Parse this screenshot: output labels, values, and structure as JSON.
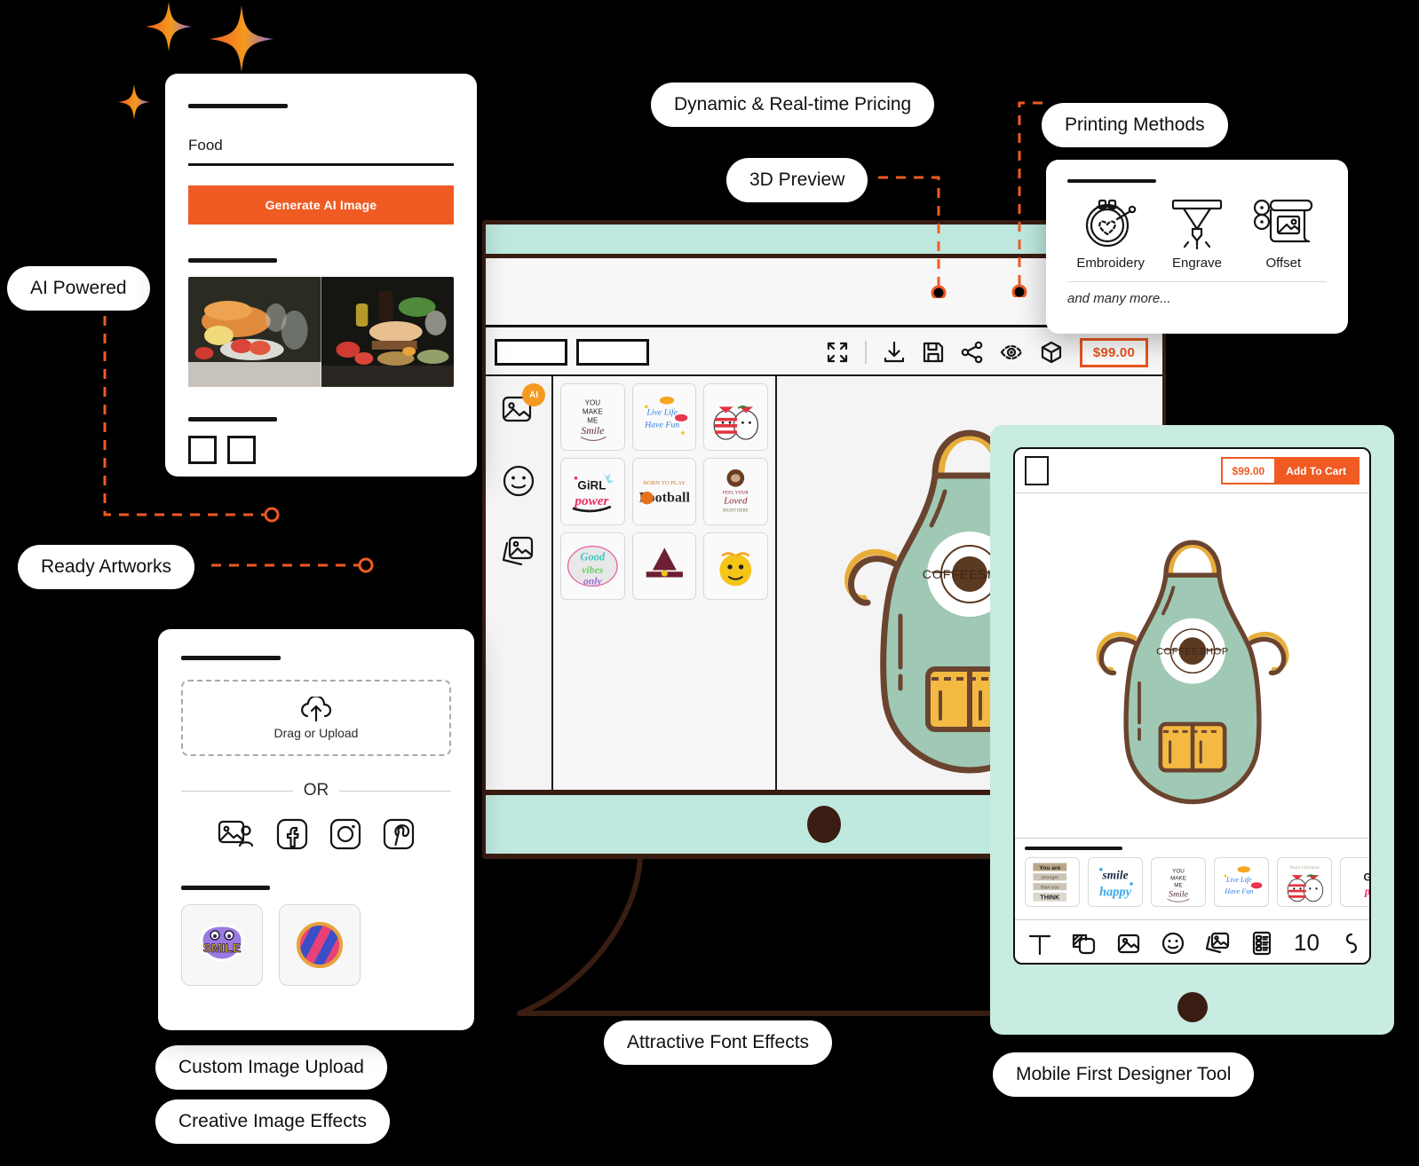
{
  "theme": {
    "background": "#000000",
    "accent_orange": "#ef5b23",
    "mint": "#c8ebe2",
    "dark_brown": "#3a1d12",
    "apron_green": "#9fc9b4",
    "apron_yellow": "#f4b942"
  },
  "callouts": [
    {
      "id": "ai-powered",
      "label": "AI Powered"
    },
    {
      "id": "ready-artworks",
      "label": "Ready Artworks"
    },
    {
      "id": "dynamic-pricing",
      "label": "Dynamic & Real-time Pricing"
    },
    {
      "id": "3d-preview",
      "label": "3D Preview"
    },
    {
      "id": "printing-methods",
      "label": "Printing Methods"
    },
    {
      "id": "custom-image-upload",
      "label": "Custom Image Upload"
    },
    {
      "id": "creative-image-effects",
      "label": "Creative Image Effects"
    },
    {
      "id": "attractive-font-effects",
      "label": "Attractive Font Effects"
    },
    {
      "id": "mobile-first",
      "label": "Mobile First Designer Tool"
    }
  ],
  "ai_card": {
    "prompt_value": "Food",
    "prompt_placeholder": "Food",
    "generate_label": "Generate AI Image",
    "thumbnail_alt_1": "ai-food-image-1",
    "thumbnail_alt_2": "ai-food-image-2"
  },
  "upload_card": {
    "dropzone_label": "Drag or Upload",
    "or_label": "OR",
    "sources": [
      "gallery-icon",
      "facebook-icon",
      "instagram-icon",
      "pinterest-icon"
    ],
    "effects": [
      "smile-sticker",
      "striped-badge-sticker"
    ]
  },
  "printing_card": {
    "methods": [
      {
        "label": "Embroidery",
        "icon": "embroidery-hoop-icon"
      },
      {
        "label": "Engrave",
        "icon": "engrave-laser-icon"
      },
      {
        "label": "Offset",
        "icon": "offset-press-icon"
      }
    ],
    "footnote": "and many more..."
  },
  "designer": {
    "price_label": "$99.00",
    "toolbar_icons": [
      "fullscreen-icon",
      "download-icon",
      "save-icon",
      "share-icon",
      "preview-eye-icon",
      "3d-cube-icon"
    ],
    "rail_icons": [
      "ai-image-icon",
      "emoji-icon",
      "artworks-icon"
    ],
    "artworks": [
      "you-make-me-smile",
      "live-life-have-fun",
      "christmas-cats",
      "girl-power",
      "born-to-play-football",
      "sloth-loved",
      "good-vibes-only",
      "witch-hat",
      "smile-face"
    ],
    "product_name": "apron",
    "logo_text": "COFFEESHOP"
  },
  "mobile": {
    "price_label": "$99.00",
    "add_to_cart_label": "Add To Cart",
    "layers_count": "10",
    "tool_icons": [
      "text-icon",
      "shapes-icon",
      "image-icon",
      "emoji-icon",
      "artworks-icon",
      "layers-list-icon"
    ],
    "artworks": [
      "you-are-stronger-than-you-think",
      "smile-and-be-happy",
      "you-make-me-smile",
      "live-life-have-fun",
      "merry-christmas-cats",
      "girl-power"
    ],
    "logo_text": "COFFEESHOP"
  }
}
